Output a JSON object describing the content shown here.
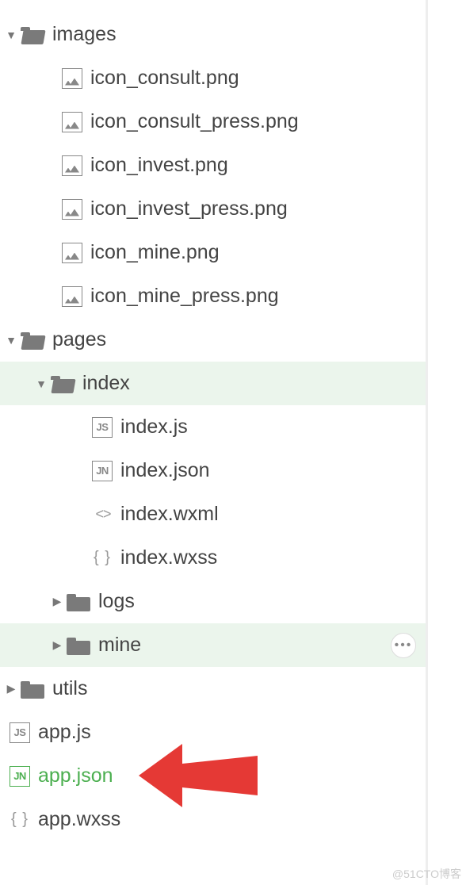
{
  "tree": {
    "images": {
      "label": "images",
      "files": [
        "icon_consult.png",
        "icon_consult_press.png",
        "icon_invest.png",
        "icon_invest_press.png",
        "icon_mine.png",
        "icon_mine_press.png"
      ]
    },
    "pages": {
      "label": "pages",
      "index": {
        "label": "index",
        "files": {
          "js": "index.js",
          "json": "index.json",
          "wxml": "index.wxml",
          "wxss": "index.wxss"
        }
      },
      "logs": {
        "label": "logs"
      },
      "mine": {
        "label": "mine"
      }
    },
    "utils": {
      "label": "utils"
    },
    "appjs": "app.js",
    "appjson": "app.json",
    "appwxss": "app.wxss"
  },
  "icons": {
    "js": "JS",
    "jn": "JN"
  },
  "watermark": "@51CTO博客"
}
